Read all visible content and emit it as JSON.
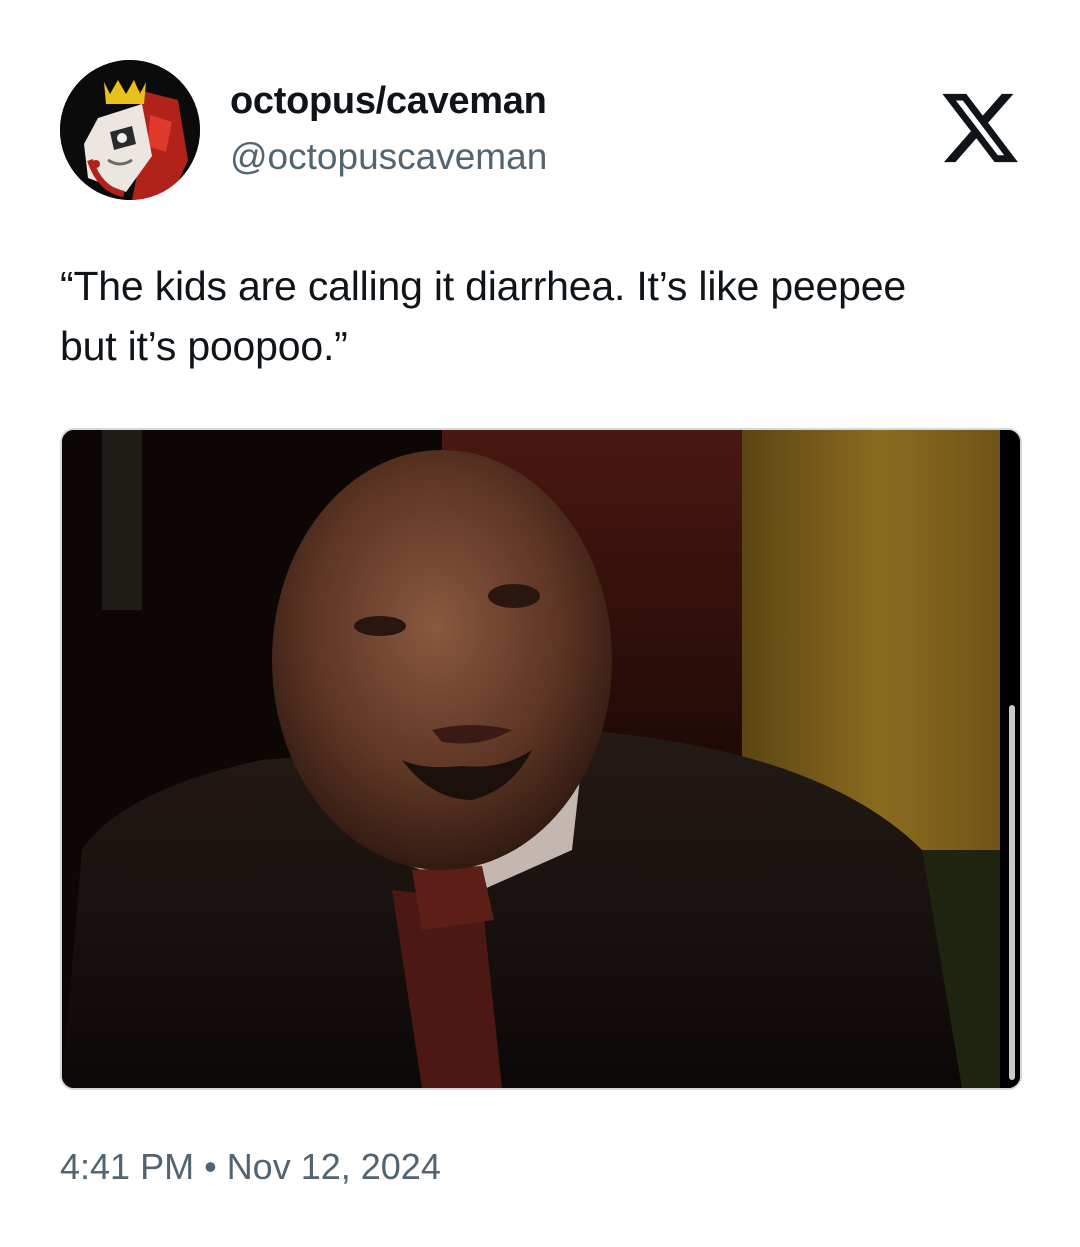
{
  "tweet": {
    "author": {
      "display_name": "octopus/caveman",
      "handle": "@octopuscaveman",
      "avatar_icon": "crowned-figure-artwork-avatar"
    },
    "platform_icon": "x-logo-icon",
    "text": "“The kids are calling it diarrhea. It’s like peepee\nbut it’s poopoo.”",
    "media": {
      "kind": "video-still",
      "scrollbar_position": 0.42
    },
    "time": "4:41 PM",
    "separator": "•",
    "date": "Nov 12, 2024"
  },
  "colors": {
    "text_primary": "#0f1419",
    "text_secondary": "#536471",
    "media_border": "#cfd9de"
  }
}
